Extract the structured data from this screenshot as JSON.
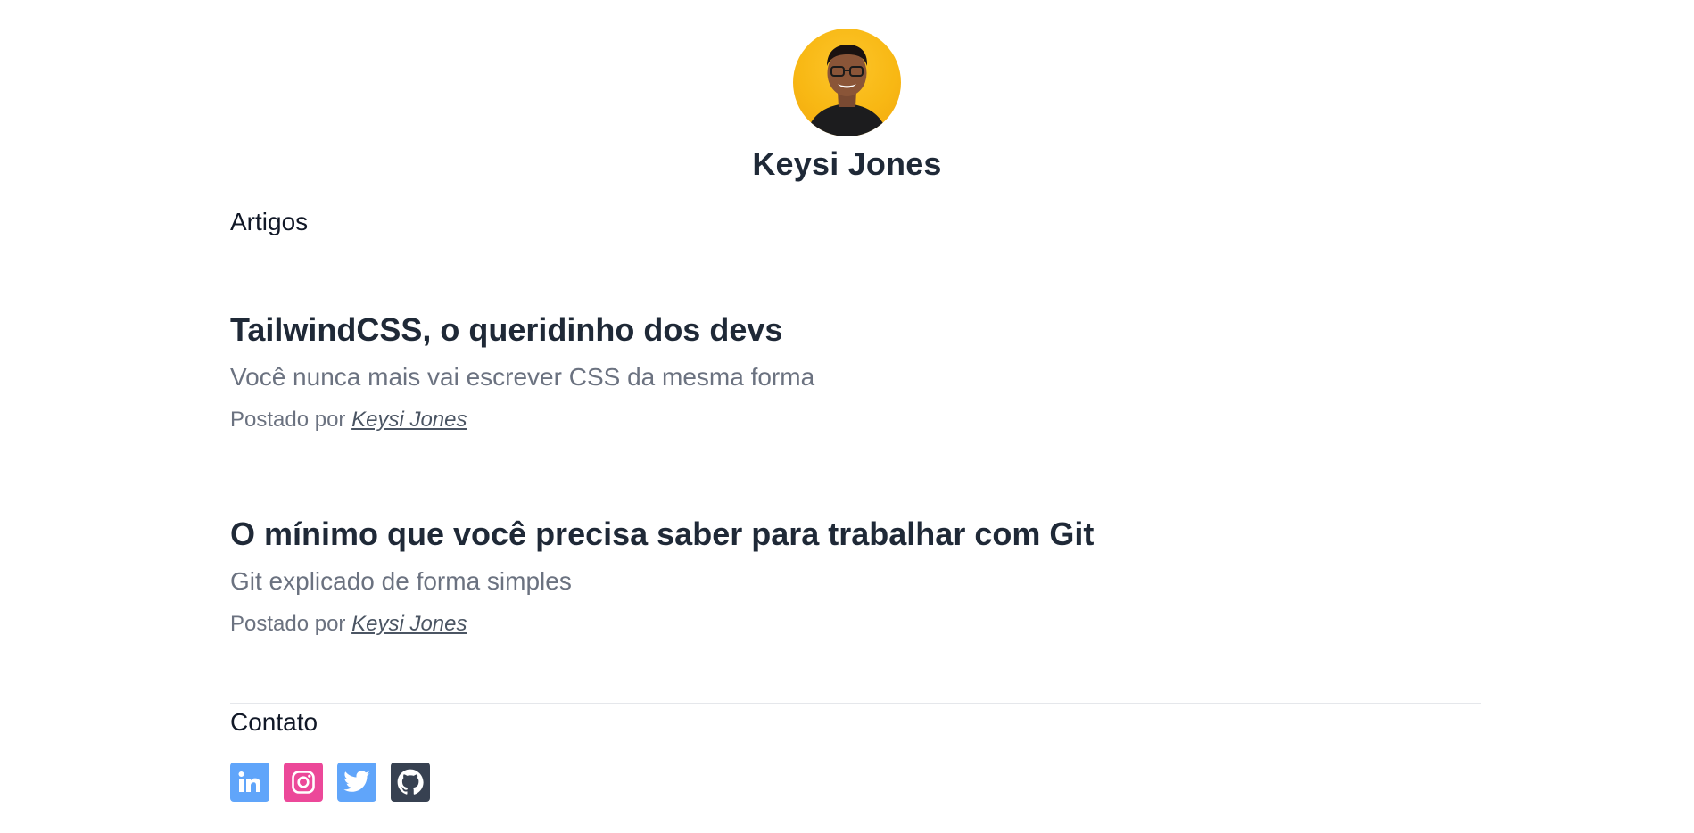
{
  "profile": {
    "name": "Keysi Jones"
  },
  "articles_section": {
    "title": "Artigos",
    "items": [
      {
        "title": "TailwindCSS, o queridinho dos devs",
        "subtitle": "Você nunca mais vai escrever CSS da mesma forma",
        "posted_by_label": "Postado por",
        "author": "Keysi Jones"
      },
      {
        "title": "O mínimo que você precisa saber para trabalhar com Git",
        "subtitle": "Git explicado de forma simples",
        "posted_by_label": "Postado por",
        "author": "Keysi Jones"
      }
    ]
  },
  "contact_section": {
    "title": "Contato",
    "socials": [
      {
        "icon": "linkedin-icon",
        "color": "#60a5fa"
      },
      {
        "icon": "instagram-icon",
        "color": "#ec4899"
      },
      {
        "icon": "twitter-icon",
        "color": "#60a5fa"
      },
      {
        "icon": "github-icon",
        "color": "#374151"
      }
    ]
  }
}
